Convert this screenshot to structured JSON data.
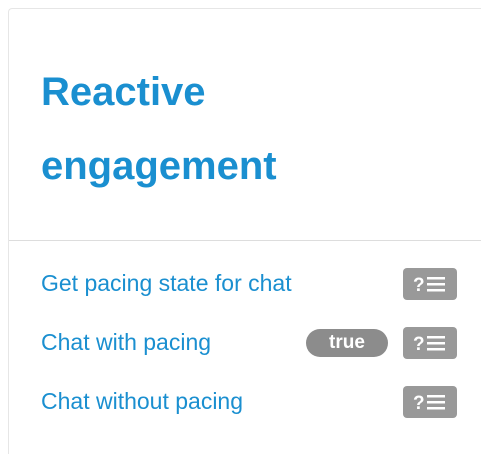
{
  "panel": {
    "title": "Reactive engagement",
    "items": [
      {
        "label": "Get pacing state for chat",
        "badge": null,
        "icon": "help-list-icon"
      },
      {
        "label": "Chat with pacing",
        "badge": "true",
        "icon": "help-list-icon"
      },
      {
        "label": "Chat without pacing",
        "badge": null,
        "icon": "help-list-icon"
      }
    ]
  },
  "colors": {
    "link": "#1a8fd0",
    "badge_bg": "#8c8c8c",
    "icon_bg": "#999999"
  }
}
